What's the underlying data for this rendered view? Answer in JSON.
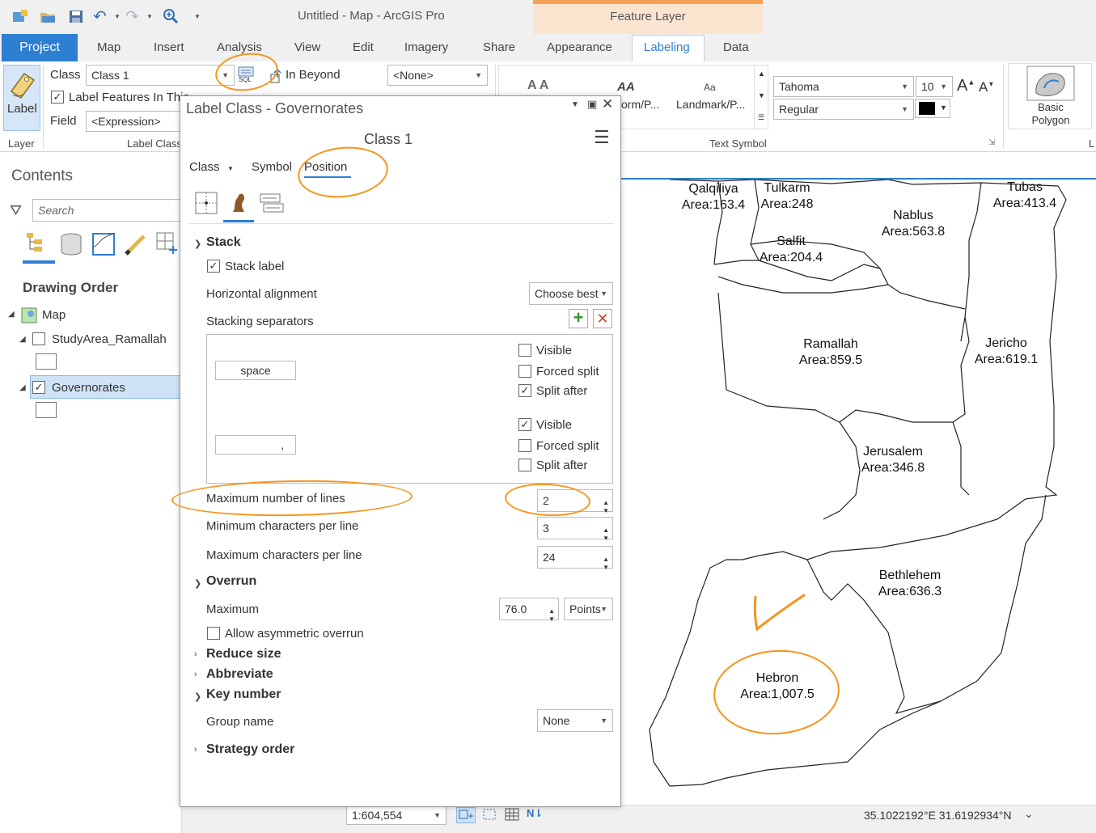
{
  "titlebar": {
    "app_title": "Untitled - Map - ArcGIS Pro",
    "contextual_group": "Feature Layer"
  },
  "tabs": {
    "project": "Project",
    "map": "Map",
    "insert": "Insert",
    "analysis": "Analysis",
    "view": "View",
    "edit": "Edit",
    "imagery": "Imagery",
    "share": "Share",
    "appearance": "Appearance",
    "labeling": "Labeling",
    "data": "Data"
  },
  "ribbon": {
    "label_button": "Label",
    "layer_group": "Layer",
    "class_label": "Class",
    "class_value": "Class 1",
    "sql_label": "SQL",
    "label_features_in": "Label Features In This",
    "in_beyond": "In Beyond",
    "none_value": "<None>",
    "field_label": "Field",
    "field_value": "<Expression>",
    "label_class_group": "Label Class",
    "aa1": "A A",
    "aa2": "AA",
    "aa3": "Aa",
    "gallery_item1": "orm/P...",
    "gallery_item2": "Landmark/P...",
    "text_symbol_group": "Text Symbol",
    "font_family": "Tahoma",
    "font_size": "10",
    "font_style": "Regular",
    "font_color": "#000000",
    "basic_polygon_line1": "Basic",
    "basic_polygon_line2": "Polygon",
    "next_group": "L"
  },
  "contents": {
    "title": "Contents",
    "search_placeholder": "Search",
    "drawing_order": "Drawing Order",
    "layers": [
      {
        "name": "Map",
        "checked": null
      },
      {
        "name": "StudyArea_Ramallah",
        "checked": false
      },
      {
        "name": "Governorates",
        "checked": true
      }
    ]
  },
  "dialog": {
    "title": "Label Class - Governorates",
    "class_name": "Class 1",
    "tabs": [
      "Class",
      "Symbol",
      "Position"
    ],
    "sections": {
      "stack": "Stack",
      "stack_label": "Stack label",
      "horizontal_alignment": "Horizontal alignment",
      "horizontal_alignment_value": "Choose best",
      "stacking_separators": "Stacking separators",
      "separators": [
        {
          "char": "space",
          "visible": false,
          "forced_split": false,
          "split_after": true
        },
        {
          "char": ",",
          "visible": true,
          "forced_split": false,
          "split_after": false
        }
      ],
      "visible": "Visible",
      "forced_split": "Forced split",
      "split_after": "Split after",
      "max_lines": "Maximum number of lines",
      "max_lines_value": "2",
      "min_chars": "Minimum characters per line",
      "min_chars_value": "3",
      "max_chars": "Maximum characters per line",
      "max_chars_value": "24",
      "overrun": "Overrun",
      "maximum": "Maximum",
      "maximum_value": "76.0",
      "maximum_units": "Points",
      "allow_asym": "Allow asymmetric overrun",
      "reduce_size": "Reduce size",
      "abbreviate": "Abbreviate",
      "key_number": "Key number",
      "group_name": "Group name",
      "group_name_value": "None",
      "strategy_order": "Strategy order"
    }
  },
  "map_labels": [
    {
      "name": "Qalqiliya",
      "area": "Area:163.4"
    },
    {
      "name": "Tulkarm",
      "area": "Area:248"
    },
    {
      "name": "Tubas",
      "area": "Area:413.4"
    },
    {
      "name": "Nablus",
      "area": "Area:563.8"
    },
    {
      "name": "Salfit",
      "area": "Area:204.4"
    },
    {
      "name": "Ramallah",
      "area": "Area:859.5"
    },
    {
      "name": "Jericho",
      "area": "Area:619.1"
    },
    {
      "name": "Jerusalem",
      "area": "Area:346.8"
    },
    {
      "name": "Bethlehem",
      "area": "Area:636.3"
    },
    {
      "name": "Hebron",
      "area": "Area:1,007.5"
    }
  ],
  "statusbar": {
    "scale": "1:604,554",
    "coords": "35.1022192°E 31.6192934°N"
  },
  "colors": {
    "accent": "#2d7fd2",
    "annotation": "#f7941d",
    "contextual": "#fbe5d1"
  }
}
